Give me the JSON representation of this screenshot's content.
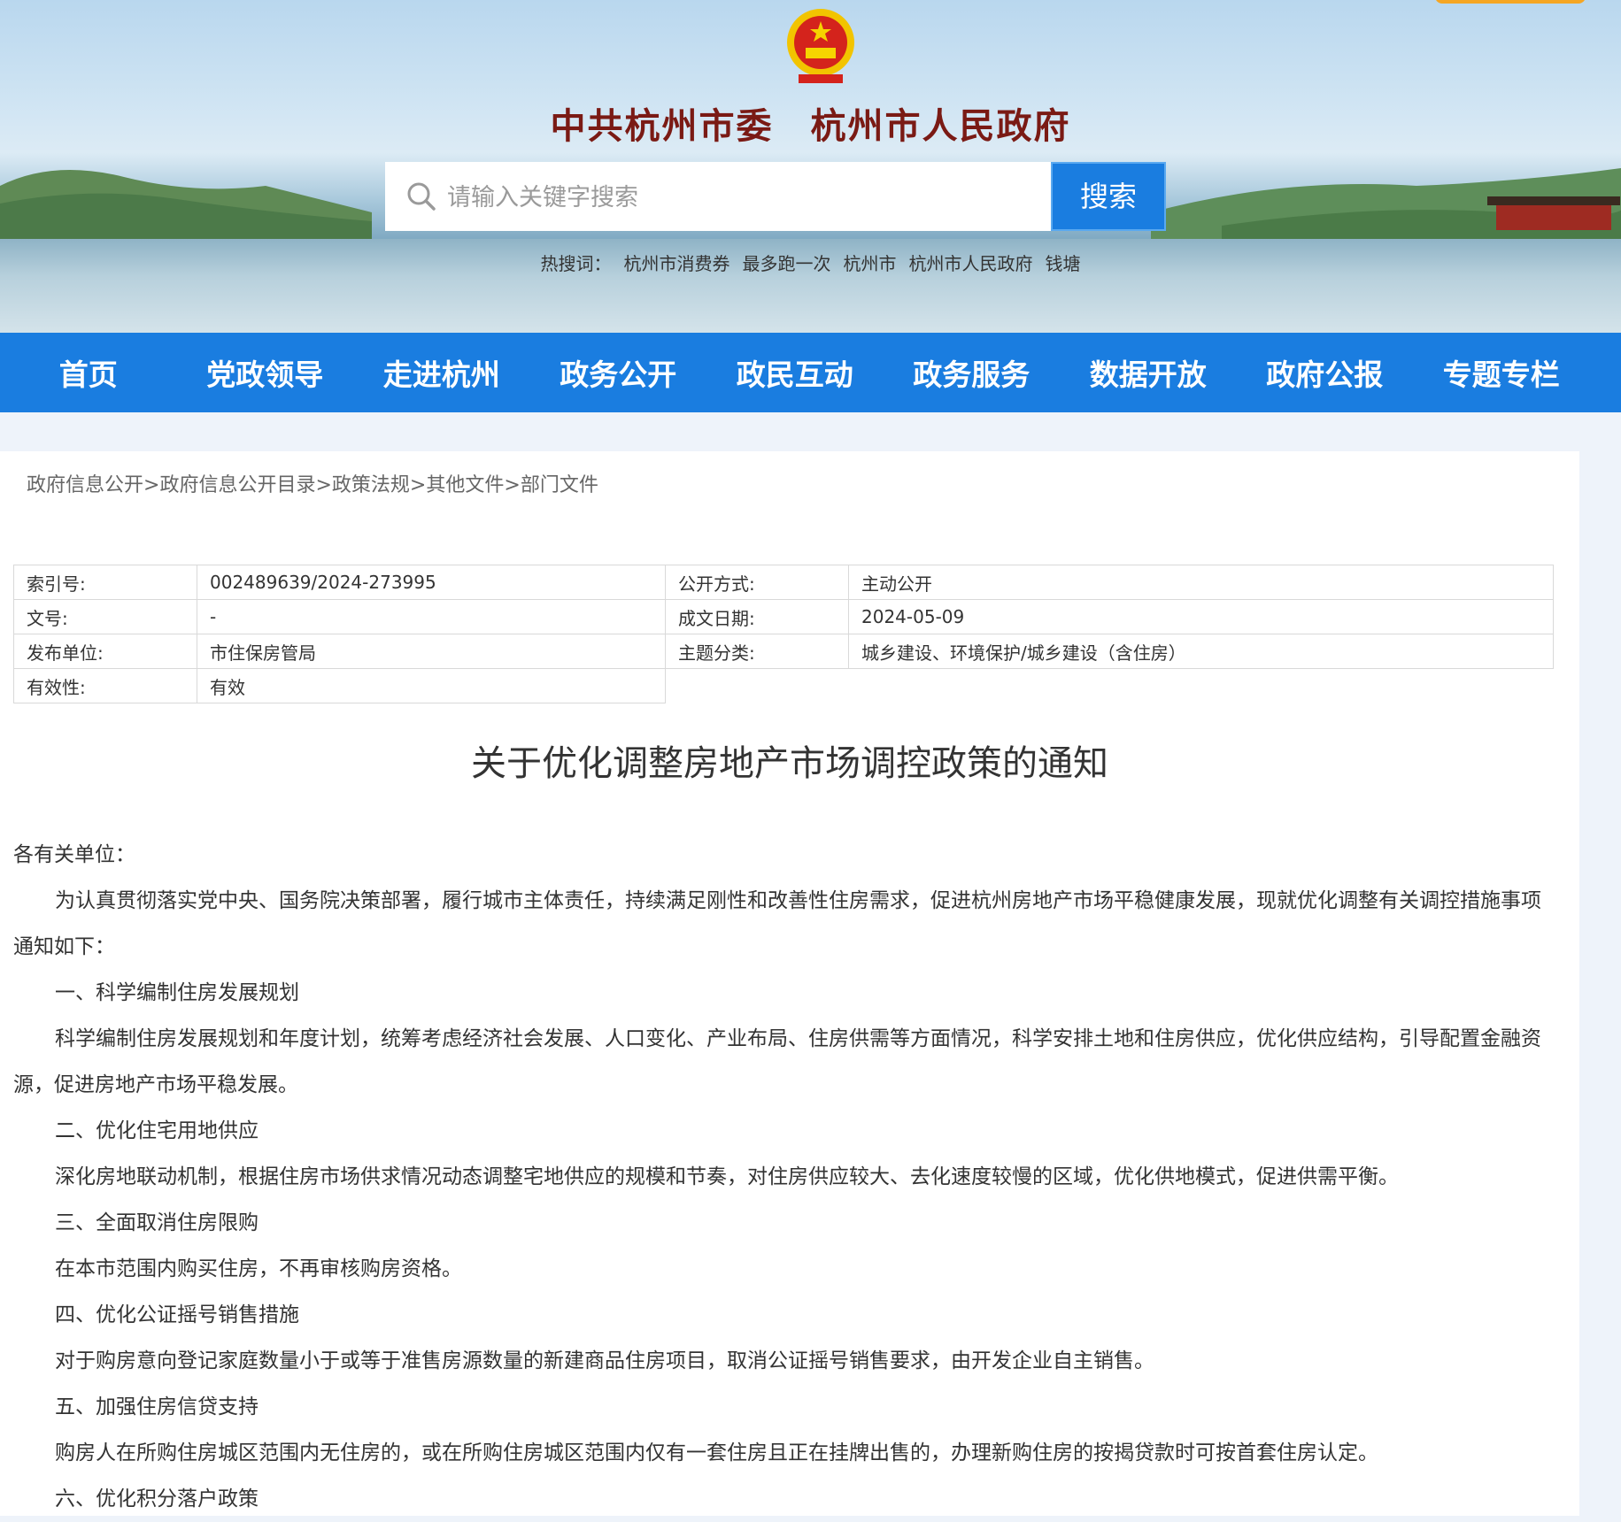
{
  "banner": {
    "site_title": "中共杭州市委　杭州市人民政府",
    "search_placeholder": "请输入关键字搜索",
    "search_button": "搜索",
    "hotwords": [
      "热搜词：",
      "杭州市消费券",
      "最多跑一次",
      "杭州市",
      "杭州市人民政府",
      "钱塘"
    ]
  },
  "nav": {
    "items": [
      "首页",
      "党政领导",
      "走进杭州",
      "政务公开",
      "政民互动",
      "政务服务",
      "数据开放",
      "政府公报",
      "专题专栏"
    ]
  },
  "breadcrumb": [
    "政府信息公开",
    "政府信息公开目录",
    "政策法规",
    "其他文件",
    "部门文件"
  ],
  "breadcrumb_sep": ">",
  "meta": {
    "index_label": "索引号:",
    "index_value": "002489639/2024-273995",
    "method_label": "公开方式:",
    "method_value": "主动公开",
    "docno_label": "文号:",
    "docno_value": "-",
    "date_label": "成文日期:",
    "date_value": "2024-05-09",
    "issuer_label": "发布单位:",
    "issuer_value": "市住保房管局",
    "topic_label": "主题分类:",
    "topic_value": "城乡建设、环境保护/城乡建设（含住房）",
    "validity_label": "有效性:",
    "validity_value": "有效"
  },
  "document": {
    "title": "关于优化调整房地产市场调控政策的通知",
    "salutation": "各有关单位：",
    "paragraphs": [
      "为认真贯彻落实党中央、国务院决策部署，履行城市主体责任，持续满足刚性和改善性住房需求，促进杭州房地产市场平稳健康发展，现就优化调整有关调控措施事项通知如下：",
      "一、科学编制住房发展规划",
      "科学编制住房发展规划和年度计划，统筹考虑经济社会发展、人口变化、产业布局、住房供需等方面情况，科学安排土地和住房供应，优化供应结构，引导配置金融资源，促进房地产市场平稳发展。",
      "二、优化住宅用地供应",
      "深化房地联动机制，根据住房市场供求情况动态调整宅地供应的规模和节奏，对住房供应较大、去化速度较慢的区域，优化供地模式，促进供需平衡。",
      "三、全面取消住房限购",
      "在本市范围内购买住房，不再审核购房资格。",
      "四、优化公证摇号销售措施",
      "对于购房意向登记家庭数量小于或等于准售房源数量的新建商品住房项目，取消公证摇号销售要求，由开发企业自主销售。",
      "五、加强住房信贷支持",
      "购房人在所购住房城区范围内无住房的，或在所购住房城区范围内仅有一套住房且正在挂牌出售的，办理新购住房的按揭贷款时可按首套住房认定。",
      "六、优化积分落户政策"
    ]
  },
  "colors": {
    "nav_blue": "#1a7de0",
    "title_red": "#7a1a14",
    "page_bg": "#eef3fa"
  }
}
